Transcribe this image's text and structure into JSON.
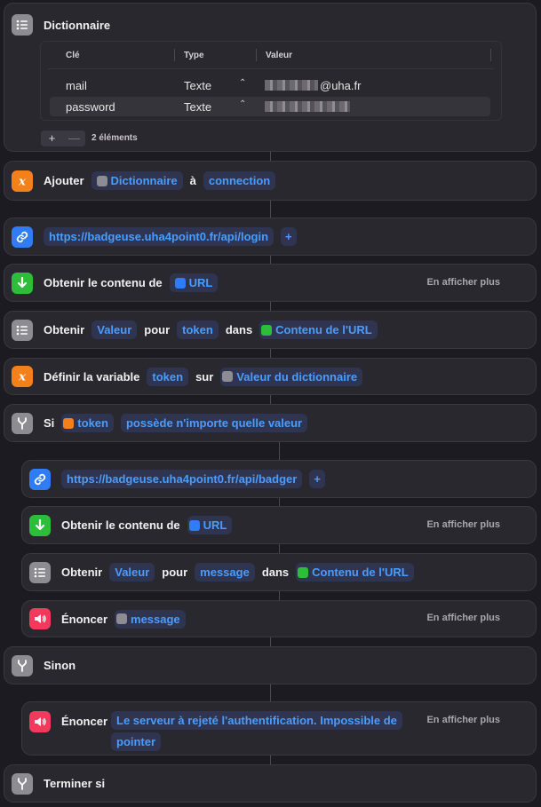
{
  "dictionary": {
    "title": "Dictionnaire",
    "columns": [
      "Clé",
      "Type",
      "Valeur"
    ],
    "rows": [
      {
        "key": "mail",
        "type": "Texte",
        "value_suffix": "@uha.fr"
      },
      {
        "key": "password",
        "type": "Texte",
        "value_suffix": ""
      }
    ],
    "add_label": "+",
    "remove_label": "—",
    "count_label": "2 éléments"
  },
  "actions": {
    "ajouter": {
      "label": "Ajouter",
      "token1": "Dictionnaire",
      "mid": "à",
      "token2": "connection"
    },
    "url1": {
      "url": "https://badgeuse.uha4point0.fr/api/login",
      "plus": "+"
    },
    "obtenir1": {
      "label": "Obtenir le contenu de",
      "token": "URL",
      "more": "En afficher plus"
    },
    "obtenir_valeur1": {
      "label": "Obtenir",
      "token1": "Valeur",
      "mid1": "pour",
      "token2": "token",
      "mid2": "dans",
      "token3": "Contenu de l'URL"
    },
    "definir": {
      "label": "Définir la variable",
      "token1": "token",
      "mid": "sur",
      "token2": "Valeur du dictionnaire"
    },
    "si": {
      "label": "Si",
      "token": "token",
      "cond": "possède n'importe quelle valeur"
    },
    "url2": {
      "url": "https://badgeuse.uha4point0.fr/api/badger",
      "plus": "+"
    },
    "obtenir2": {
      "label": "Obtenir le contenu de",
      "token": "URL",
      "more": "En afficher plus"
    },
    "obtenir_valeur2": {
      "label": "Obtenir",
      "token1": "Valeur",
      "mid1": "pour",
      "token2": "message",
      "mid2": "dans",
      "token3": "Contenu de l'URL"
    },
    "enoncer1": {
      "label": "Énoncer",
      "token": "message",
      "more": "En afficher plus"
    },
    "sinon": {
      "label": "Sinon"
    },
    "enoncer2": {
      "label": "Énoncer",
      "text_line1": "Le serveur à rejeté l'authentification. Impossible de",
      "text_line2": "pointer",
      "more": "En afficher plus"
    },
    "terminer": {
      "label": "Terminer si"
    }
  },
  "colors": {
    "orange": "#f4801a",
    "blue": "#2f7cf6",
    "green": "#2dbd3a",
    "red": "#f23a5d",
    "gray": "#8e8c93",
    "token_text": "#4a9cff"
  }
}
